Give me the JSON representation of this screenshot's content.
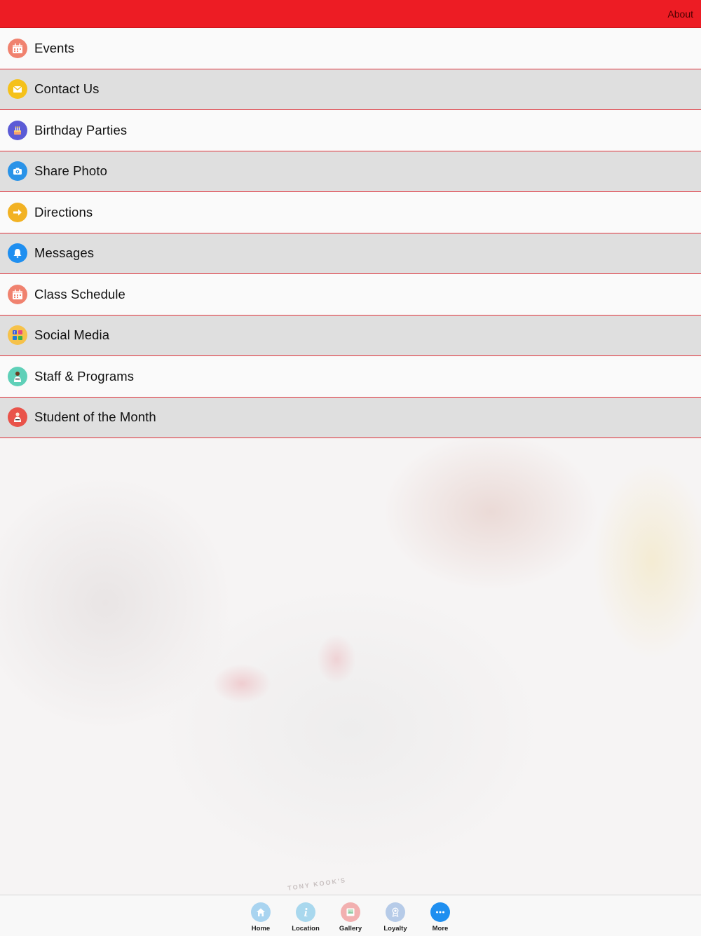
{
  "header": {
    "about_label": "About",
    "bar_color": "#ed1c24"
  },
  "menu": [
    {
      "label": "Events",
      "icon": "calendar-icon",
      "color": "#f0826f"
    },
    {
      "label": "Contact Us",
      "icon": "envelope-icon",
      "color": "#f5c11a"
    },
    {
      "label": "Birthday Parties",
      "icon": "cake-icon",
      "color": "#5b5bd6"
    },
    {
      "label": "Share Photo",
      "icon": "camera-icon",
      "color": "#2a93e8"
    },
    {
      "label": "Directions",
      "icon": "arrow-right-icon",
      "color": "#f2b223"
    },
    {
      "label": "Messages",
      "icon": "bell-icon",
      "color": "#1f8ff0"
    },
    {
      "label": "Class Schedule",
      "icon": "calendar-icon",
      "color": "#f0826f"
    },
    {
      "label": "Social Media",
      "icon": "social-media-icon",
      "color": "#f6c24a"
    },
    {
      "label": "Staff & Programs",
      "icon": "staff-icon",
      "color": "#5fd0b8"
    },
    {
      "label": "Student of the Month",
      "icon": "student-icon",
      "color": "#e9534a"
    }
  ],
  "tabs": [
    {
      "label": "Home",
      "icon": "home-icon",
      "color": "#a9d4f0"
    },
    {
      "label": "Location",
      "icon": "info-icon",
      "color": "#a9d8ee"
    },
    {
      "label": "Gallery",
      "icon": "gallery-icon",
      "color": "#f2b0b0"
    },
    {
      "label": "Loyalty",
      "icon": "award-icon",
      "color": "#b6cbe8"
    },
    {
      "label": "More",
      "icon": "more-icon",
      "color": "#1f8ff0"
    }
  ],
  "watermark_text": "TONY KOOK'S"
}
